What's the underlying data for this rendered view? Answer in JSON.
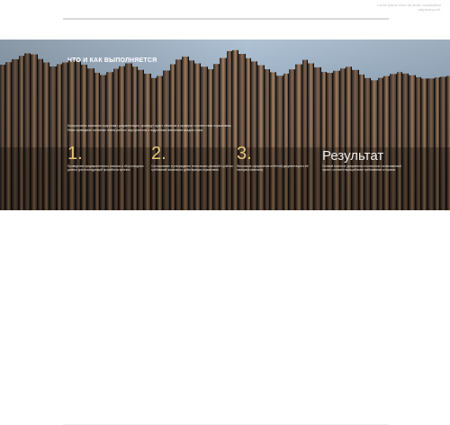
{
  "header": {
    "right_text": "Lorem ipsum dolor sit amet, consectetur adipiscing elit."
  },
  "section": {
    "title": "ЧТО И КАК ВЫПОЛНЯЕТСЯ",
    "intro": "Консультанты компании подготовят документацию, проведут аудит объектов и проверят соответствие нормативам. Ниже приведены основные этапы работы над проектом с подробным описанием каждого шага.",
    "steps": [
      {
        "number": "1.",
        "description": "Проведение предварительного анализа и сбор исходных данных для последующей проработки проекта."
      },
      {
        "number": "2.",
        "description": "Согласование и утверждение технических решений с учётом требований заказчика и действующих нормативов."
      },
      {
        "number": "3.",
        "description": "Финальное оформление отчётной документации и её передача заказчику."
      },
      {
        "number": "",
        "title": "Результат",
        "description": "Готовый комплект документов и полностью согласованный проект, соответствующий всем требованиям и нормам."
      }
    ]
  },
  "colors": {
    "accent": "#e7c77a",
    "title_text": "#ffffff",
    "body_text": "#ebe6df"
  }
}
